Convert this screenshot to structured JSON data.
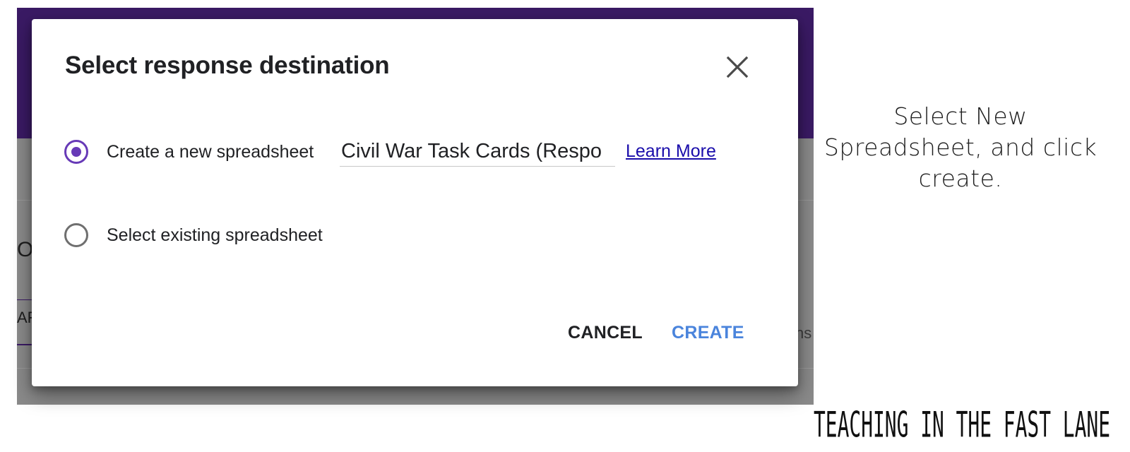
{
  "background": {
    "peek_letter": "O",
    "peek_tab": "AF",
    "peek_right": "ns"
  },
  "dialog": {
    "title": "Select response destination",
    "close_icon": "close-icon",
    "options": [
      {
        "label": "Create a new spreadsheet",
        "selected": true
      },
      {
        "label": "Select existing spreadsheet",
        "selected": false
      }
    ],
    "spreadsheet_name": "Civil War Task Cards (Respo",
    "learn_more": "Learn More",
    "cancel_label": "CANCEL",
    "create_label": "CREATE"
  },
  "instruction": "Select New Spreadsheet, and click create.",
  "watermark": "TEACHING IN THE FAST LANE",
  "colors": {
    "header_purple": "#3a1a64",
    "radio_accent": "#673ab7",
    "create_blue": "#4a84dc",
    "link_blue": "#1a0dab"
  }
}
